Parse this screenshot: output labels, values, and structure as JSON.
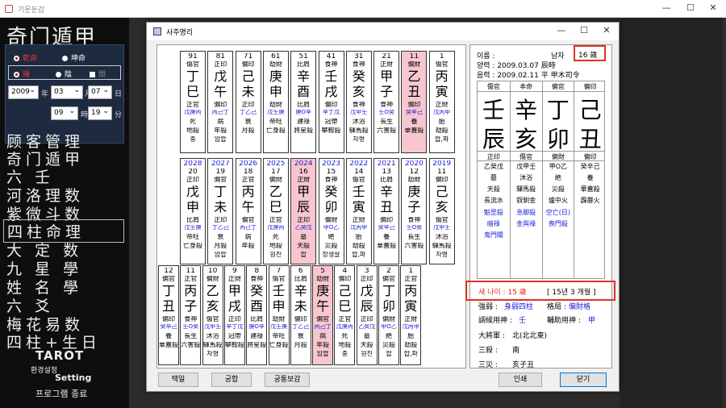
{
  "window": {
    "title": "기문둔갑",
    "min": "—",
    "max": "☐",
    "close": "✕"
  },
  "logo": "奇门遁甲",
  "gender": {
    "male": "乾命",
    "female": "坤命"
  },
  "yinyang": {
    "yang": "陽",
    "yin": "陰",
    "leap": "閏"
  },
  "date": {
    "year": "2009",
    "year_unit": "年",
    "month": "03",
    "month_unit": "月",
    "day": "07",
    "day_unit": "日",
    "hour": "09",
    "hour_unit": "時",
    "minute": "19",
    "minute_unit": "分"
  },
  "menu": [
    "顾客管理",
    "奇门遁甲",
    "六 壬",
    "河洛理数",
    "紫微斗数",
    "四柱命理",
    "大 定 数",
    "九 星 學",
    "姓 名 學",
    "六 爻",
    "梅花易数",
    "四柱+生日",
    "TAROT",
    "환경설정",
    "Setting",
    "프로그램 종료"
  ],
  "dialog": {
    "title": "사주명리",
    "buttons": {
      "taek": "택일",
      "gunghap": "궁합",
      "gunghap2": "궁통보감",
      "print": "인쇄",
      "close": "닫기"
    }
  },
  "row1": [
    {
      "age": "91",
      "g": "傷官",
      "s": "丁",
      "b": "巳",
      "r": "正官",
      "b1": "戊庚丙",
      "st": "死",
      "k1": "地殺",
      "k2": "충",
      "hl": false
    },
    {
      "age": "81",
      "g": "正印",
      "s": "戊",
      "b": "午",
      "r": "偏印",
      "b1": "丙己丁",
      "st": "病",
      "k1": "年殺",
      "k2": "암합",
      "hl": false
    },
    {
      "age": "71",
      "g": "偏印",
      "s": "己",
      "b": "未",
      "r": "正印",
      "b1": "丁乙己",
      "st": "衰",
      "k1": "月殺",
      "k2": "",
      "hl": false
    },
    {
      "age": "61",
      "g": "劫財",
      "s": "庚",
      "b": "申",
      "r": "劫財",
      "b1": "戊壬庚",
      "st": "帝旺",
      "k1": "亡身殺",
      "k2": "",
      "hl": false
    },
    {
      "age": "51",
      "g": "比肩",
      "s": "辛",
      "b": "酉",
      "r": "比肩",
      "b1": "庚O辛",
      "st": "建祿",
      "k1": "將星殺",
      "k2": "",
      "hl": false
    },
    {
      "age": "41",
      "g": "食神",
      "s": "壬",
      "b": "戌",
      "r": "偏印",
      "b1": "辛丁戊",
      "st": "冠帶",
      "k1": "攀鞍殺",
      "k2": "",
      "hl": false
    },
    {
      "age": "31",
      "g": "食神",
      "s": "癸",
      "b": "亥",
      "r": "食神",
      "b1": "戊甲壬",
      "st": "沐浴",
      "k1": "驛馬殺",
      "k2": "자형",
      "hl": false
    },
    {
      "age": "21",
      "g": "正財",
      "s": "甲",
      "b": "子",
      "r": "食神",
      "b1": "壬O癸",
      "st": "長生",
      "k1": "六害殺",
      "k2": "",
      "hl": false
    },
    {
      "age": "11",
      "g": "偏財",
      "s": "乙",
      "b": "丑",
      "r": "偏印",
      "b1": "癸辛己",
      "st": "養",
      "k1": "華蓋殺",
      "k2": "",
      "hl": true
    },
    {
      "age": "1",
      "g": "傷官",
      "s": "丙",
      "b": "寅",
      "r": "正財",
      "b1": "戊丙甲",
      "st": "胎",
      "k1": "劫殺",
      "k2": "합,파",
      "hl": false
    }
  ],
  "row2": [
    {
      "yr": "2028",
      "age": "20",
      "g": "正印",
      "s": "戊",
      "b": "申",
      "r": "比肩",
      "b1": "戊壬庚",
      "st": "帝旺",
      "k1": "亡身殺",
      "k2": "",
      "hl": false
    },
    {
      "yr": "2027",
      "age": "19",
      "g": "偏官",
      "s": "丁",
      "b": "未",
      "r": "正印",
      "b1": "丁乙己",
      "st": "衰",
      "k1": "月殺",
      "k2": "암합",
      "hl": false
    },
    {
      "yr": "2026",
      "age": "18",
      "g": "正官",
      "s": "丙",
      "b": "午",
      "r": "偏官",
      "b1": "丙己丁",
      "st": "病",
      "k1": "年殺",
      "k2": "",
      "hl": false
    },
    {
      "yr": "2025",
      "age": "17",
      "g": "偏財",
      "s": "乙",
      "b": "巳",
      "r": "正官",
      "b1": "戊庚丙",
      "st": "死",
      "k1": "地殺",
      "k2": "원진",
      "hl": false
    },
    {
      "yr": "2024",
      "age": "16",
      "g": "正財",
      "s": "甲",
      "b": "辰",
      "r": "正印",
      "b1": "乙癸戊",
      "st": "墓",
      "k1": "天殺",
      "k2": "합",
      "hl": true
    },
    {
      "yr": "2023",
      "age": "15",
      "g": "食神",
      "s": "癸",
      "b": "卯",
      "r": "偏財",
      "b1": "甲O乙",
      "st": "絶",
      "k1": "災殺",
      "k2": "장생살",
      "hl": false
    },
    {
      "yr": "2022",
      "age": "14",
      "g": "傷官",
      "s": "壬",
      "b": "寅",
      "r": "正財",
      "b1": "戊丙甲",
      "st": "胎",
      "k1": "劫殺",
      "k2": "합,파",
      "hl": false
    },
    {
      "yr": "2021",
      "age": "13",
      "g": "比肩",
      "s": "辛",
      "b": "丑",
      "r": "偏印",
      "b1": "癸辛己",
      "st": "養",
      "k1": "華蓋殺",
      "k2": "",
      "hl": false
    },
    {
      "yr": "2020",
      "age": "12",
      "g": "劫財",
      "s": "庚",
      "b": "子",
      "r": "食神",
      "b1": "壬O癸",
      "st": "長生",
      "k1": "六害殺",
      "k2": "",
      "hl": false
    },
    {
      "yr": "2019",
      "age": "11",
      "g": "偏印",
      "s": "己",
      "b": "亥",
      "r": "傷官",
      "b1": "戊甲壬",
      "st": "沐浴",
      "k1": "驛馬殺",
      "k2": "자형",
      "hl": false
    }
  ],
  "row3": [
    {
      "age": "12",
      "g": "偏官",
      "s": "丁",
      "b": "丑",
      "r": "偏印",
      "b1": "癸辛己",
      "st": "養",
      "k1": "華蓋殺",
      "k2": "",
      "hl": false
    },
    {
      "age": "11",
      "g": "正官",
      "s": "丙",
      "b": "子",
      "r": "食神",
      "b1": "壬O癸",
      "st": "長生",
      "k1": "六害殺",
      "k2": "",
      "hl": false
    },
    {
      "age": "10",
      "g": "偏財",
      "s": "乙",
      "b": "亥",
      "r": "傷官",
      "b1": "戊甲壬",
      "st": "沐浴",
      "k1": "驛馬殺",
      "k2": "자형",
      "hl": false
    },
    {
      "age": "9",
      "g": "正財",
      "s": "甲",
      "b": "戌",
      "r": "正印",
      "b1": "辛丁戊",
      "st": "冠帶",
      "k1": "攀鞍殺",
      "k2": "",
      "hl": false
    },
    {
      "age": "8",
      "g": "食神",
      "s": "癸",
      "b": "酉",
      "r": "比肩",
      "b1": "庚O辛",
      "st": "建祿",
      "k1": "將星殺",
      "k2": "",
      "hl": false
    },
    {
      "age": "7",
      "g": "傷官",
      "s": "壬",
      "b": "申",
      "r": "劫財",
      "b1": "戊壬庚",
      "st": "帝旺",
      "k1": "亡身殺",
      "k2": "",
      "hl": false
    },
    {
      "age": "6",
      "g": "比肩",
      "s": "辛",
      "b": "未",
      "r": "偏印",
      "b1": "丁乙己",
      "st": "衰",
      "k1": "月殺",
      "k2": "",
      "hl": false
    },
    {
      "age": "5",
      "g": "劫財",
      "s": "庚",
      "b": "午",
      "r": "偏官",
      "b1": "丙己丁",
      "st": "病",
      "k1": "年殺",
      "k2": "암합",
      "hl": true
    },
    {
      "age": "4",
      "g": "偏印",
      "s": "己",
      "b": "巳",
      "r": "正官",
      "b1": "戊庚丙",
      "st": "死",
      "k1": "地殺",
      "k2": "충",
      "hl": false
    },
    {
      "age": "3",
      "g": "正印",
      "s": "戊",
      "b": "辰",
      "r": "正印",
      "b1": "乙癸戊",
      "st": "墓",
      "k1": "天殺",
      "k2": "원진",
      "hl": false
    },
    {
      "age": "2",
      "g": "偏官",
      "s": "丁",
      "b": "卯",
      "r": "偏財",
      "b1": "甲O乙",
      "st": "絶",
      "k1": "災殺",
      "k2": "합",
      "hl": false
    },
    {
      "age": "1",
      "g": "正官",
      "s": "丙",
      "b": "寅",
      "r": "正財",
      "b1": "戊丙甲",
      "st": "胎",
      "k1": "劫殺",
      "k2": "합,파",
      "hl": false
    }
  ],
  "info": {
    "name_label": "이름 :",
    "gender": "남자",
    "age_box": "16 歲",
    "solar": "양력 : 2009.03.07 辰時",
    "lunar": "음력 : 2009.02.11 平 甲木司令"
  },
  "chart": {
    "heads": [
      "傷官",
      "本命",
      "偏官",
      "偏印"
    ],
    "stems": [
      "壬",
      "辛",
      "丁",
      "己"
    ],
    "branches": [
      "辰",
      "亥",
      "卯",
      "丑"
    ],
    "sub": [
      "正印",
      "傷官",
      "偏財",
      "偏印"
    ],
    "b1": [
      "乙癸戊",
      "戊甲壬",
      "甲O乙",
      "癸辛己"
    ],
    "b2": [
      "墓",
      "沐浴",
      "絶",
      "養"
    ],
    "b3": [
      "天殺",
      "驛馬殺",
      "災殺",
      "華蓋殺"
    ],
    "b4": [
      "長流水",
      "釵釧金",
      "爐中火",
      "霹靂火"
    ],
    "b5": [
      "魁罡殺",
      "急脚殺",
      "空亡(日)",
      ""
    ],
    "b6": [
      "暗祿",
      "金與祿",
      "喪門殺",
      ""
    ],
    "b7": [
      "鬼門關",
      "",
      "",
      ""
    ]
  },
  "newage": {
    "label": "새 나이 : 15 歲",
    "detail": "[ 15년 3 개월 ]"
  },
  "analysis": {
    "strength_l": "強弱 :",
    "strength_v": "身弱四柱",
    "gyeok_l": "格局 :",
    "gyeok_v": "偏財格",
    "yong_l": "調候用神 :",
    "yong_v": "壬",
    "help_l": "輔助用神 :",
    "help_v": "甲",
    "dj_l": "大將軍 :",
    "dj_v": "北(北北東)",
    "sam_l": "三殺 :",
    "sam_v": "南",
    "sj_l": "三災 :",
    "sj_v": "亥子丑"
  }
}
